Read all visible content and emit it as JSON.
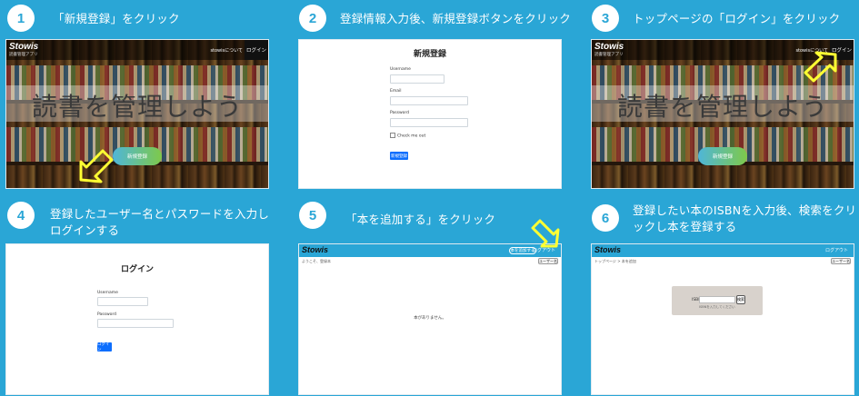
{
  "colors": {
    "background": "#2aa6d6",
    "arrow": "#ffff33",
    "button": "#0d6efd"
  },
  "steps": [
    {
      "num": "1",
      "text": "「新規登録」をクリック"
    },
    {
      "num": "2",
      "text": "登録情報入力後、新規登録ボタンをクリック"
    },
    {
      "num": "3",
      "text": "トップページの「ログイン」をクリック"
    },
    {
      "num": "4",
      "text_line1": "登録したユーザー名とパスワードを入力し",
      "text_line2": "ログインする"
    },
    {
      "num": "5",
      "text": "「本を追加する」をクリック"
    },
    {
      "num": "6",
      "text_line1": "登録したい本のISBNを入力後、検索をクリ",
      "text_line2": "ックし本を登録する"
    }
  ],
  "hero": {
    "logo": "Stowis",
    "logo_sub": "読書管理アプリ",
    "about_link": "stowisについて",
    "login_button": "ログイン",
    "title": "読書を管理しよう",
    "register_button": "新規登録"
  },
  "register_form": {
    "title": "新規登録",
    "username_label": "Username",
    "email_label": "Email",
    "password_label": "Password",
    "check_label": "Check me out",
    "submit_label": "新規登録"
  },
  "login_form": {
    "title": "ログイン",
    "username_label": "Username",
    "password_label": "Password",
    "submit_label": "ログイン"
  },
  "app": {
    "logo": "Stowis",
    "add_book_button": "本を追加する",
    "logout_link": "ログアウト",
    "user_button": "ユーザー名",
    "welcome_text": "ようこそ、登録本",
    "empty_text": "本がありません。",
    "isbn_breadcrumb": "トップページ > 本を追加",
    "isbn_label": "ISBN",
    "isbn_button": "検索",
    "isbn_note": "ISBNを入力してください"
  }
}
